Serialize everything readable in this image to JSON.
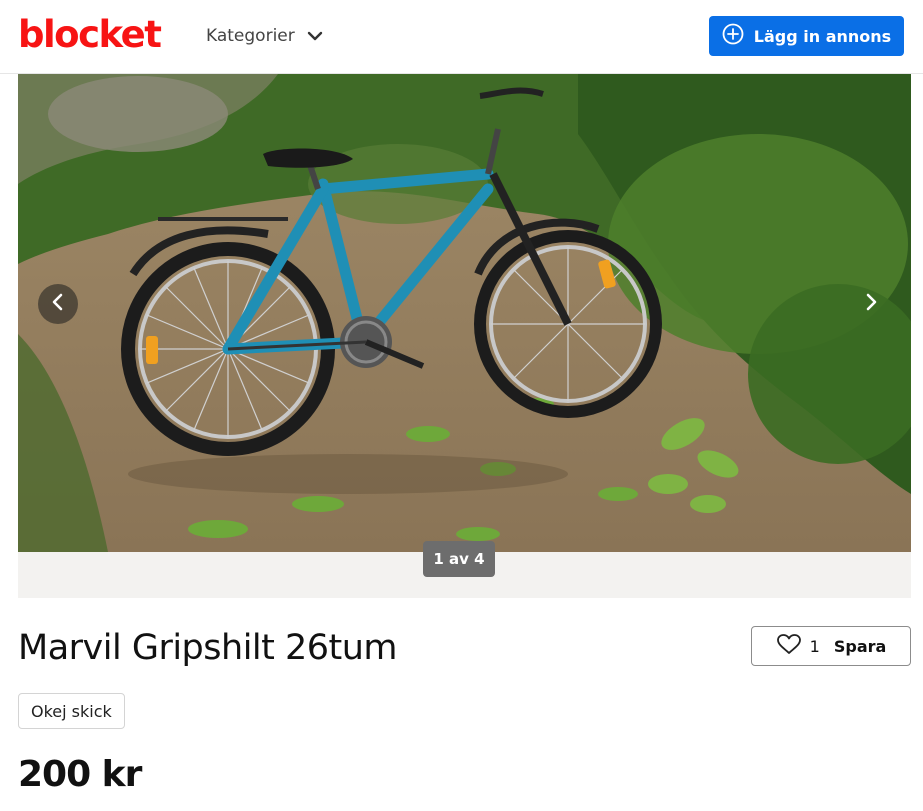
{
  "header": {
    "logo": "blocket",
    "categories_label": "Kategorier",
    "add_listing_label": "Lägg in annons"
  },
  "gallery": {
    "counter": "1 av 4",
    "image_alt": "Blå cykel mot buskar",
    "prev_icon": "chevron-left-icon",
    "next_icon": "chevron-right-icon"
  },
  "listing": {
    "title": "Marvil Gripshilt 26tum",
    "condition": "Okej skick",
    "price": "200 kr",
    "save": {
      "count": "1",
      "label": "Spara"
    }
  },
  "colors": {
    "brand": "#f71414",
    "primary_button": "#0a6fe6",
    "bike_frame": "#1f8fb5"
  }
}
